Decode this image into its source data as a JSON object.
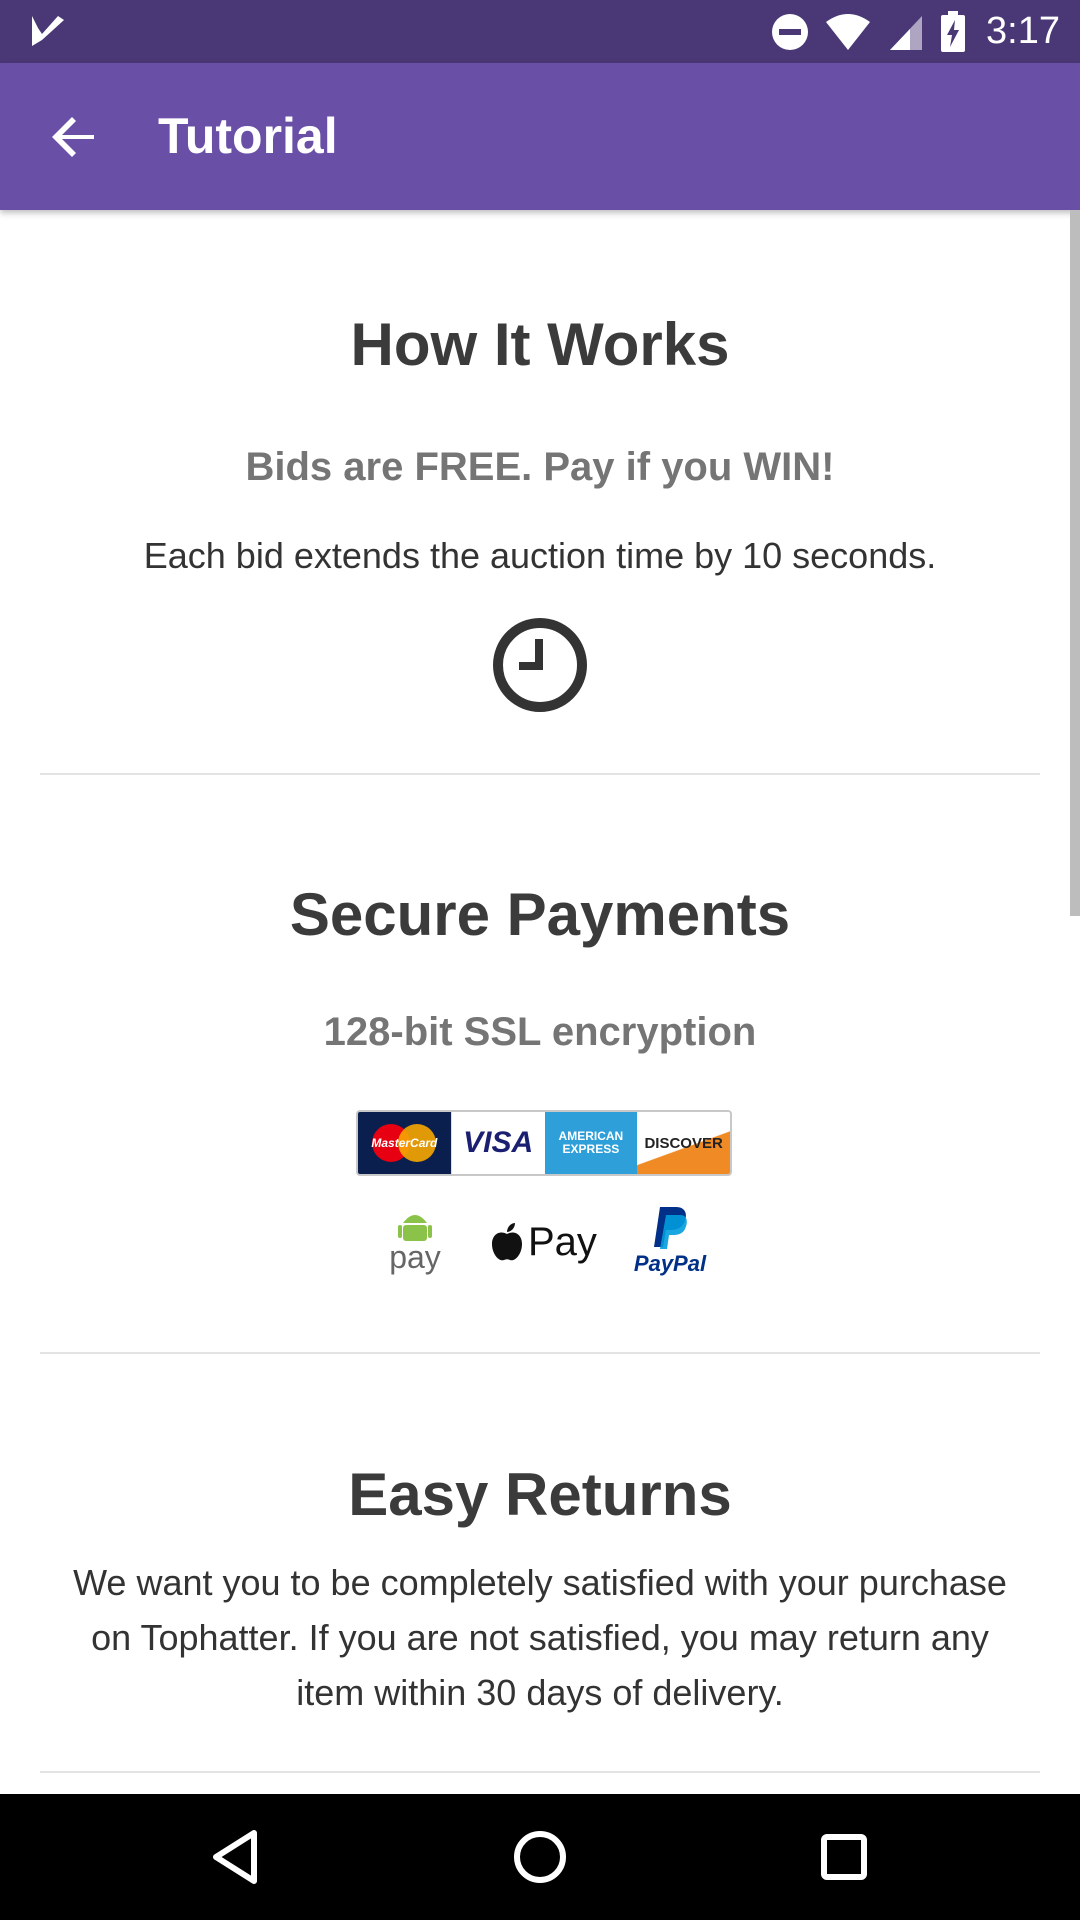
{
  "status_bar": {
    "time": "3:17",
    "icons": [
      "app-check-icon",
      "do-not-disturb-icon",
      "wifi-icon",
      "signal-icon",
      "battery-charging-icon"
    ]
  },
  "app_bar": {
    "title": "Tutorial",
    "back_icon": "arrow-back-icon"
  },
  "how_it_works": {
    "title": "How It Works",
    "subtitle": "Bids are FREE. Pay if you WIN!",
    "body": "Each bid extends the auction time by 10 seconds.",
    "icon": "clock-icon"
  },
  "secure_payments": {
    "title": "Secure Payments",
    "subtitle": "128-bit SSL encryption",
    "cards": [
      "MasterCard",
      "VISA",
      "AMERICAN EXPRESS",
      "DISCOVER"
    ],
    "wallets": [
      "pay",
      "Pay",
      "PayPal"
    ]
  },
  "easy_returns": {
    "title": "Easy Returns",
    "body_line1": "We want you to be completely satisfied with your purchase",
    "body_line2": "on Tophatter. If you are not satisfied, you may return any",
    "body_line3": "item within 30 days of delivery."
  },
  "nav_bar": {
    "icons": [
      "back-triangle-icon",
      "home-circle-icon",
      "recents-square-icon"
    ]
  },
  "colors": {
    "status_bar": "#4a3876",
    "app_bar": "#6a4fa7",
    "nav_bar": "#000000"
  }
}
